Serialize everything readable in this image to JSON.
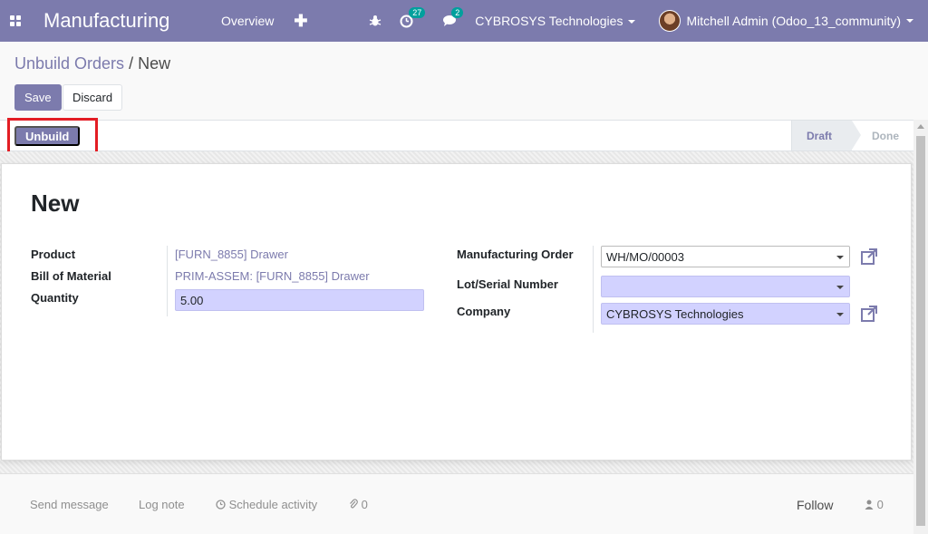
{
  "navbar": {
    "app_name": "Manufacturing",
    "menu_overview": "Overview",
    "menu_plus": "✚",
    "activity_count": "27",
    "message_count": "2",
    "company": "CYBROSYS Technologies",
    "user": "Mitchell Admin (Odoo_13_community)",
    "icons": [
      "apps-icon",
      "bug-icon",
      "activity-clock-icon",
      "chat-icon",
      "avatar"
    ],
    "accent_color": "#7c7bad",
    "badge_color": "#00a09d"
  },
  "breadcrumb": {
    "parent": "Unbuild Orders",
    "separator": "/",
    "current": "New"
  },
  "buttons": {
    "save": "Save",
    "discard": "Discard",
    "unbuild": "Unbuild"
  },
  "statusbar": {
    "stages": [
      "Draft",
      "Done"
    ],
    "active_stage": "Draft"
  },
  "form": {
    "title": "New",
    "left": {
      "product_label": "Product",
      "product_value": "[FURN_8855] Drawer",
      "bom_label": "Bill of Material",
      "bom_value": "PRIM-ASSEM: [FURN_8855] Drawer",
      "quantity_label": "Quantity",
      "quantity_value": "5.00"
    },
    "right": {
      "mo_label": "Manufacturing Order",
      "mo_value": "WH/MO/00003",
      "lot_label": "Lot/Serial Number",
      "lot_value": "",
      "company_label": "Company",
      "company_value": "CYBROSYS Technologies"
    },
    "required_field_color": "#d2d2ff"
  },
  "chatter": {
    "send_message": "Send message",
    "log_note": "Log note",
    "schedule_activity": "Schedule activity",
    "attachments": "0",
    "follow": "Follow",
    "followers": "0"
  },
  "highlight_color": "#e31d24"
}
